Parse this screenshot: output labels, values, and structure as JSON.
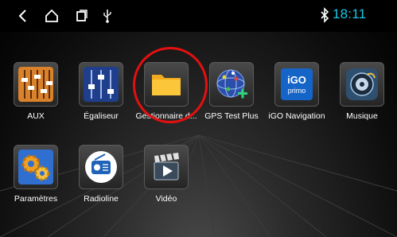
{
  "status_bar": {
    "icons": [
      "back-icon",
      "home-icon",
      "recent-apps-icon",
      "usb-icon",
      "bluetooth-icon"
    ],
    "time": "18:11",
    "time_color": "#19c7e6"
  },
  "apps": [
    {
      "label": "AUX",
      "icon": "aux-fader-icon"
    },
    {
      "label": "Égaliseur",
      "icon": "equalizer-sliders-icon"
    },
    {
      "label": "Gestionnaire d...",
      "icon": "folder-icon"
    },
    {
      "label": "GPS Test Plus",
      "icon": "gps-globe-icon"
    },
    {
      "label": "iGO Navigation",
      "icon": "igo-primo-icon",
      "icon_text": "iGO",
      "icon_subtext": "primo"
    },
    {
      "label": "Musique",
      "icon": "music-speaker-icon"
    },
    {
      "label": "Paramètres",
      "icon": "settings-gears-icon"
    },
    {
      "label": "Radioline",
      "icon": "radio-icon"
    },
    {
      "label": "Vidéo",
      "icon": "video-clapper-icon"
    }
  ],
  "highlight": {
    "target": "Gestionnaire d...",
    "color": "#e41010"
  }
}
